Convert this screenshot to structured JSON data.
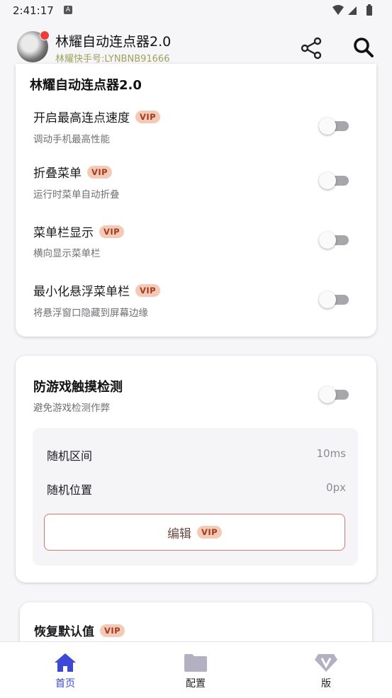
{
  "status_bar": {
    "time": "2:41:17",
    "notif_icon": "A"
  },
  "header": {
    "title": "林耀自动连点器2.0",
    "subtitle": "林耀快手号:LYNBNB91666"
  },
  "card1": {
    "title": "林耀自动连点器2.0",
    "rows": [
      {
        "title": "开启最高连点速度",
        "sub": "调动手机最高性能",
        "vip": "VIP",
        "on": false
      },
      {
        "title": "折叠菜单",
        "sub": "运行时菜单自动折叠",
        "vip": "VIP",
        "on": false
      },
      {
        "title": "菜单栏显示",
        "sub": "横向显示菜单栏",
        "vip": "VIP",
        "on": false
      },
      {
        "title": "最小化悬浮菜单栏",
        "sub": "将悬浮窗口隐藏到屏幕边缘",
        "vip": "VIP",
        "on": false
      }
    ]
  },
  "card2": {
    "title": "防游戏触摸检测",
    "sub": "避免游戏检测作弊",
    "on": false,
    "params": [
      {
        "label": "随机区间",
        "value": "10ms"
      },
      {
        "label": "随机位置",
        "value": "0px"
      }
    ],
    "edit_label": "编辑",
    "edit_vip": "VIP"
  },
  "card3": {
    "title": "恢复默认值",
    "vip": "VIP"
  },
  "bottom_nav": {
    "items": [
      {
        "label": "首页",
        "icon": "home-icon",
        "active": true
      },
      {
        "label": "配置",
        "icon": "folder-icon",
        "active": false
      },
      {
        "label": "版",
        "icon": "diamond-v-icon",
        "active": false
      }
    ]
  },
  "colors": {
    "accent": "#3b49d6",
    "vip_bg": "#f4c9b6",
    "vip_text": "#a23b20",
    "edit_border": "#d2786c"
  }
}
